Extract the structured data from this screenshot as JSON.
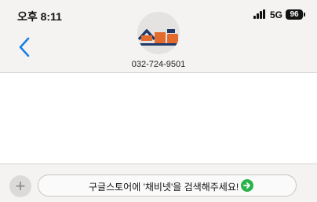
{
  "status_bar": {
    "time": "오후 8:11",
    "network": "5G",
    "battery": "96"
  },
  "contact": {
    "phone": "032-724-9501",
    "avatar_icon": "house-logo-icon"
  },
  "composer": {
    "text": "구글스토어에 '채비넷'을 검색해주세요!"
  },
  "icons": {
    "back": "chevron-left-icon",
    "add": "plus-icon",
    "send": "arrow-right-icon"
  },
  "colors": {
    "accent": "#1a7fe6",
    "go": "#2ab34a",
    "logo_navy": "#1f3a6b",
    "logo_orange": "#e26a2c"
  }
}
